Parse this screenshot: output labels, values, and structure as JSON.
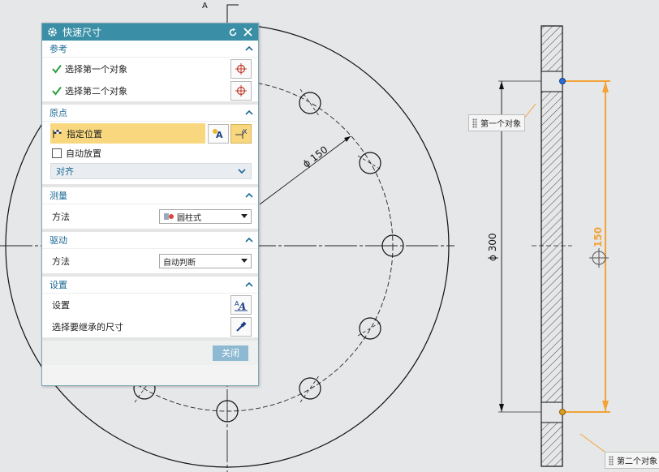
{
  "dialog": {
    "title": "快速尺寸",
    "sections": {
      "reference": {
        "label": "参考",
        "first": "选择第一个对象",
        "second": "选择第二个对象"
      },
      "origin": {
        "label": "原点",
        "specify": "指定位置",
        "auto_place": "自动放置",
        "align": "对齐"
      },
      "measure": {
        "label": "测量",
        "method_label": "方法",
        "method_value": "圆柱式"
      },
      "drive": {
        "label": "驱动",
        "method_label": "方法",
        "method_value": "自动判断"
      },
      "settings": {
        "label": "设置",
        "settings_label": "设置",
        "inherit_label": "选择要继承的尺寸"
      }
    },
    "close_label": "关闭"
  },
  "drawing": {
    "axis_mark": "A",
    "dim_pitch_circle": "ϕ 150",
    "dim_outer": "ϕ 300",
    "dim_active": "150",
    "callout_first": "第一个对象",
    "callout_second": "第二个对象"
  },
  "colors": {
    "titlebar": "#3a8fa6",
    "accent_orange": "#f2a33a",
    "highlight": "#f8d77e",
    "link_blue": "#1c6a94"
  }
}
